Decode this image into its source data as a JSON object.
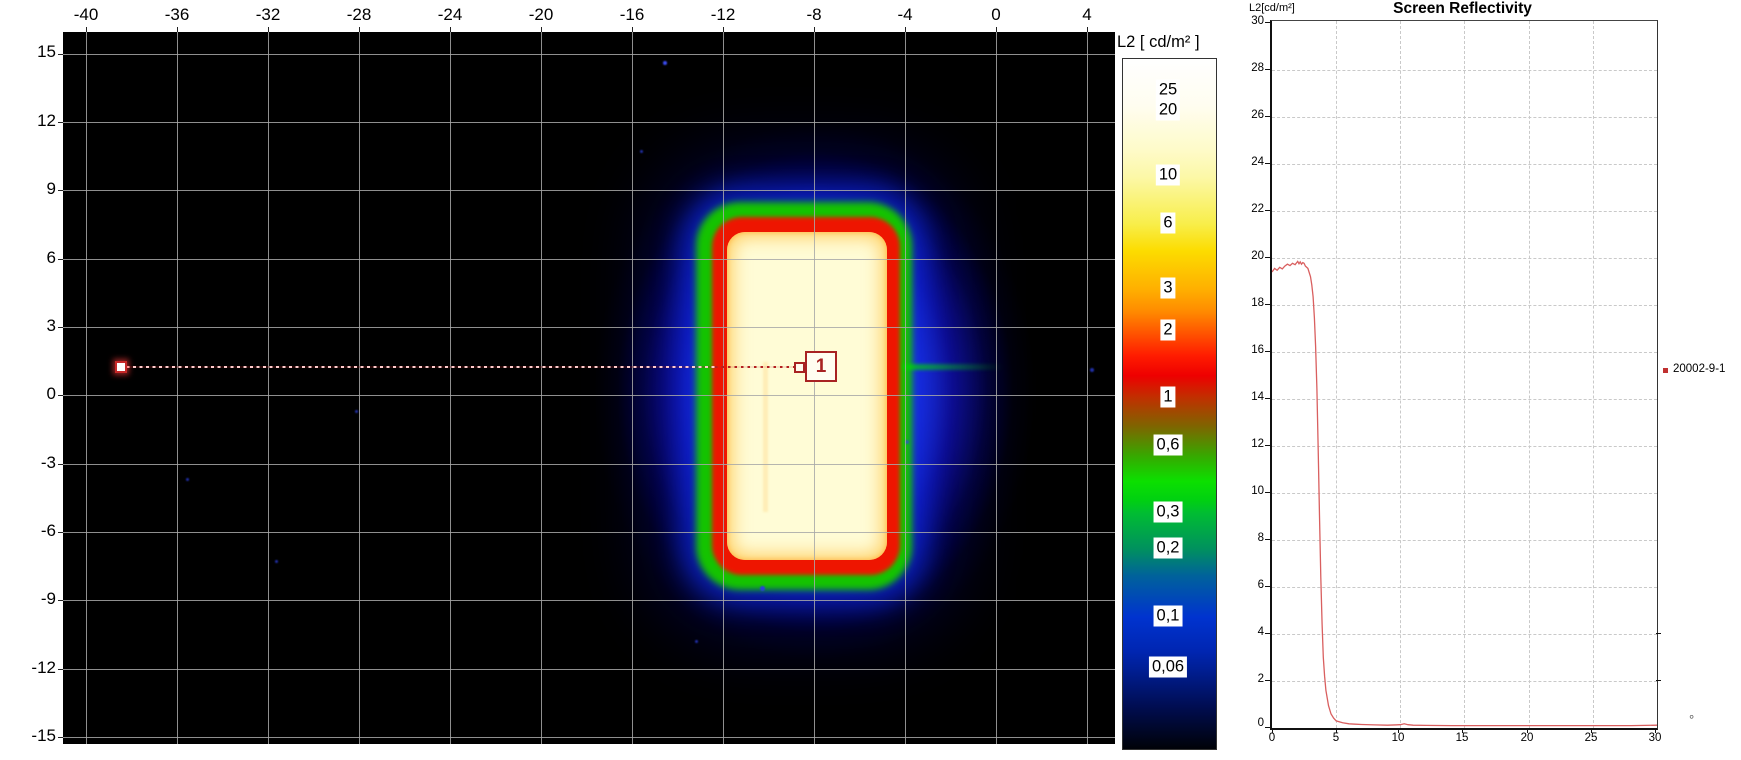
{
  "heatmap": {
    "x_tick_labels": [
      "-40",
      "-36",
      "-32",
      "-28",
      "-24",
      "-20",
      "-16",
      "-12",
      "-8",
      "-4",
      "0",
      "4"
    ],
    "y_tick_labels": [
      "15",
      "12",
      "9",
      "6",
      "3",
      "0",
      "-3",
      "-6",
      "-9",
      "-12",
      "-15"
    ],
    "marker": {
      "id": "1"
    }
  },
  "colorbar": {
    "title": "L2 [ cd/m² ]",
    "tick_labels": [
      "25",
      "20",
      "10",
      "6",
      "3",
      "2",
      "1",
      "0,6",
      "0,3",
      "0,2",
      "0,1",
      "0,06"
    ]
  },
  "profile_chart": {
    "axis_label": "L2[cd/m²]",
    "title": "Screen Reflectivity",
    "y_tick_labels": [
      "30",
      "28",
      "26",
      "24",
      "22",
      "20",
      "18",
      "16",
      "14",
      "12",
      "10",
      "8",
      "6",
      "4",
      "2",
      "0"
    ],
    "x_tick_labels": [
      "0",
      "5",
      "10",
      "15",
      "20",
      "25",
      "30"
    ],
    "legend": {
      "label": "20002-9-1",
      "marker_color": "#c03030"
    },
    "degree_symbol": "°"
  },
  "chart_data": [
    {
      "type": "heatmap",
      "title": "",
      "x_range": [
        -41,
        5.2
      ],
      "y_range": [
        -15.5,
        15.4
      ],
      "x_ticks": [
        -40,
        -36,
        -32,
        -28,
        -24,
        -20,
        -16,
        -12,
        -8,
        -4,
        0,
        4
      ],
      "y_ticks": [
        15,
        12,
        9,
        6,
        3,
        0,
        -3,
        -6,
        -9,
        -12,
        -15
      ],
      "background_level": 0,
      "colorbar": {
        "title": "L2 [ cd/m² ]",
        "unit": "cd/m²",
        "scale_type": "log",
        "scale_values": [
          25,
          20,
          10,
          6,
          3,
          2,
          1,
          0.6,
          0.3,
          0.2,
          0.1,
          0.06
        ]
      },
      "bright_region": {
        "shape": "rounded-rect",
        "x_extent": [
          -11.8,
          -4.8
        ],
        "y_extent": [
          -7.3,
          7.2
        ],
        "peak_level": 25,
        "border_rings": [
          "red ~2 cd/m²",
          "green ~0.4 cd/m²",
          "blue halo ~0.1 cd/m²"
        ]
      },
      "profile_marker": {
        "id": "1",
        "y": 1.2,
        "x_start": -38.5,
        "x_end": -8.7
      }
    },
    {
      "type": "line",
      "title": "Screen Reflectivity",
      "xlabel": "",
      "ylabel": "L2[cd/m²]",
      "xlim": [
        0,
        30
      ],
      "ylim": [
        0,
        30
      ],
      "x_tick_step": 5,
      "y_tick_step": 2,
      "grid": "dashed",
      "legend_position": "right-middle",
      "series": [
        {
          "name": "20002-9-1",
          "color": "#d95f5f",
          "x": [
            0,
            0.2,
            0.4,
            0.6,
            0.8,
            1.0,
            1.2,
            1.4,
            1.6,
            1.8,
            2.0,
            2.1,
            2.2,
            2.3,
            2.4,
            2.5,
            2.6,
            2.8,
            3.0,
            3.1,
            3.2,
            3.3,
            3.4,
            3.5,
            3.6,
            3.7,
            3.8,
            3.9,
            4.0,
            4.1,
            4.2,
            4.4,
            4.6,
            4.8,
            5.0,
            5.5,
            6.0,
            6.5,
            7.0,
            8.0,
            9.0,
            10.0,
            10.3,
            10.6,
            11.0,
            12.0,
            14.0,
            16.0,
            18.0,
            20.0,
            22.0,
            24.0,
            26.0,
            28.0,
            30.0
          ],
          "y": [
            19.35,
            19.5,
            19.42,
            19.55,
            19.48,
            19.6,
            19.68,
            19.62,
            19.72,
            19.66,
            19.8,
            19.7,
            19.78,
            19.68,
            19.75,
            19.72,
            19.6,
            19.5,
            19.15,
            18.8,
            18.3,
            17.4,
            16.2,
            14.4,
            11.8,
            9.0,
            6.4,
            4.4,
            3.0,
            2.2,
            1.6,
            0.95,
            0.6,
            0.42,
            0.3,
            0.22,
            0.18,
            0.16,
            0.15,
            0.13,
            0.12,
            0.14,
            0.18,
            0.14,
            0.12,
            0.11,
            0.1,
            0.1,
            0.1,
            0.1,
            0.1,
            0.1,
            0.1,
            0.1,
            0.12
          ]
        }
      ]
    }
  ]
}
